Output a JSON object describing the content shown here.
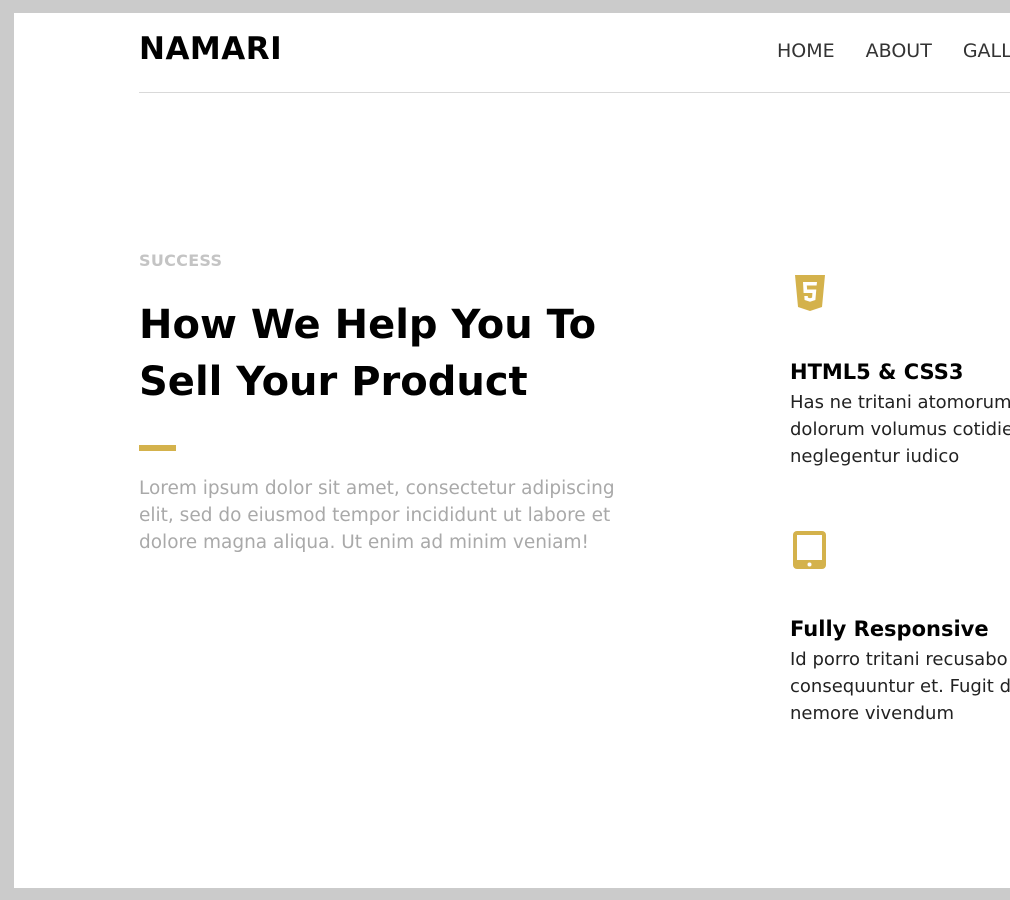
{
  "brand": {
    "logo": "NAMARI"
  },
  "nav": {
    "items": [
      "HOME",
      "ABOUT",
      "GALLERY"
    ]
  },
  "hero": {
    "eyebrow": "SUCCESS",
    "title_line1": "How We Help You To",
    "title_line2": "Sell Your Product",
    "intro": "Lorem ipsum dolor sit amet, consectetur adipiscing elit, sed do eiusmod tempor incididunt ut labore et dolore magna aliqua. Ut enim ad minim veniam!"
  },
  "features": [
    {
      "icon": "html5-icon",
      "title": "HTML5 & CSS3",
      "lines": [
        "Has ne tritani atomorum",
        "dolorum volumus cotidie",
        "neglegentur iudico"
      ]
    },
    {
      "icon": "tablet-icon",
      "title": "Fully Responsive",
      "lines": [
        "Id porro tritani recusabo",
        "consequuntur et. Fugit d",
        "nemore vivendum"
      ]
    }
  ],
  "colors": {
    "accent": "#d4b24c",
    "eyebrow": "#c4c4c4",
    "intro_text": "#a9a9a9",
    "backdrop": "#cbcbcb"
  }
}
